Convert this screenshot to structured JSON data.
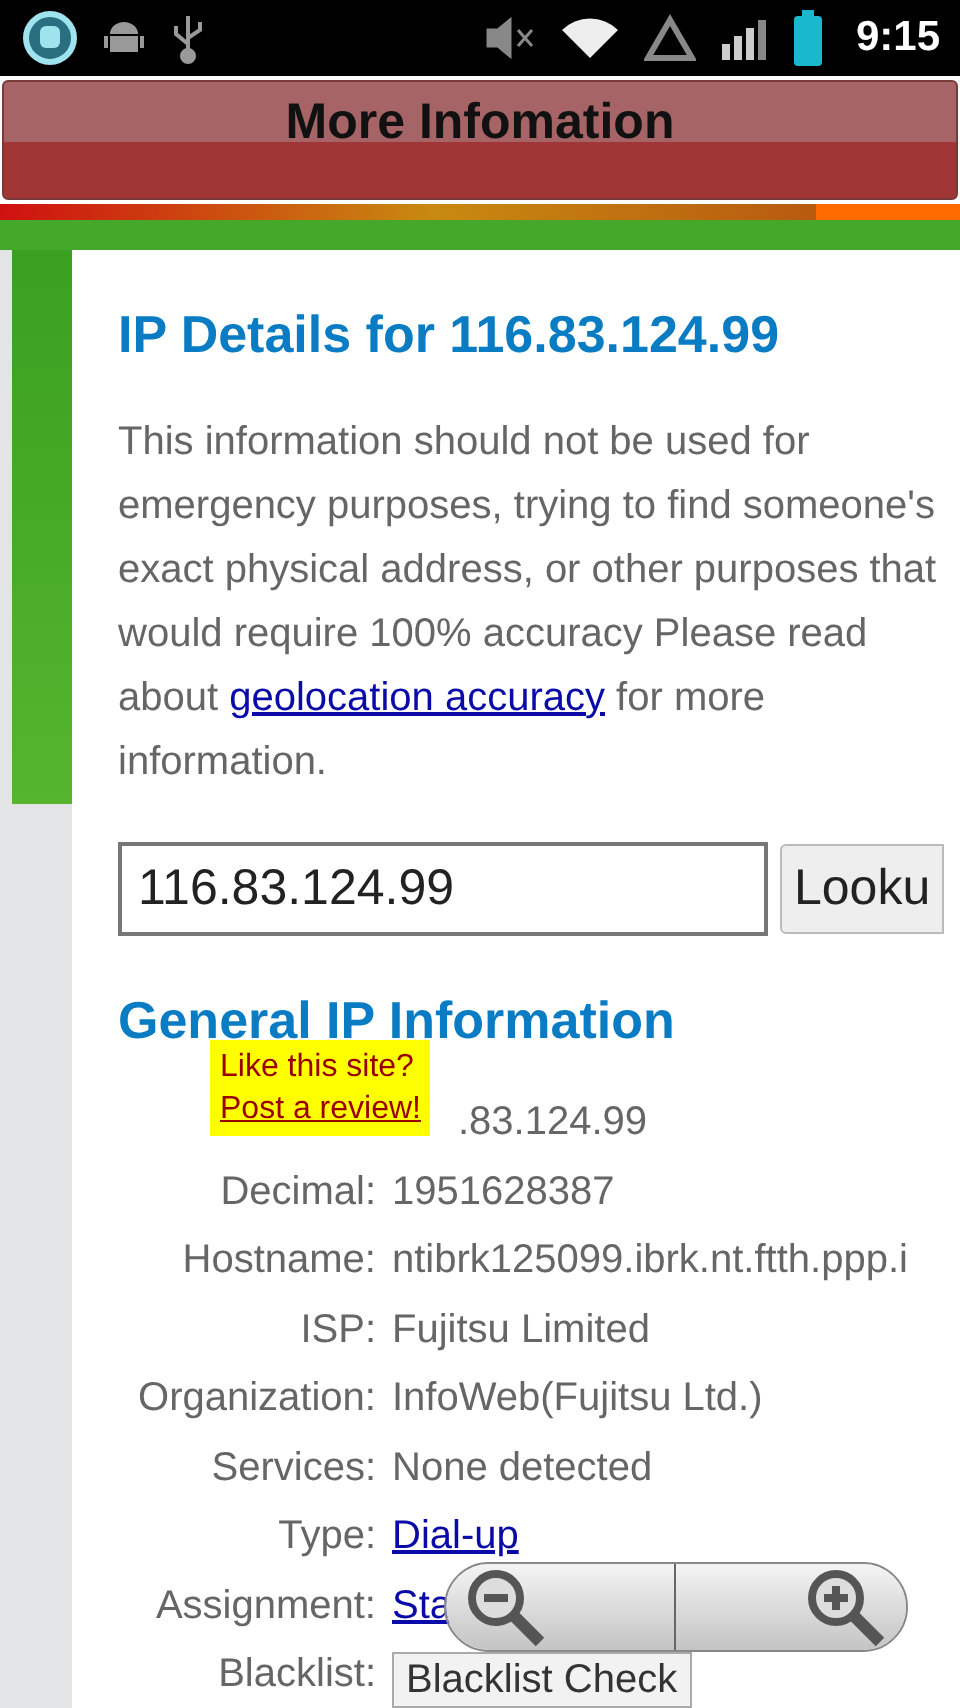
{
  "status_bar": {
    "time": "9:15"
  },
  "title_bar": {
    "title": "More Infomation"
  },
  "page": {
    "heading": "IP Details for 116.83.124.99",
    "notice_before": "This information should not be used for emergency purposes, trying to find someone's exact physical address, or other purposes that would require 100% accuracy Please read about",
    "notice_link": "geolocation accuracy",
    "notice_after": "for more information.",
    "lookup": {
      "value": "116.83.124.99",
      "button": "Looku"
    },
    "section_heading": "General IP Information",
    "review_tip": {
      "text": "Like this site?",
      "link": "Post a review!"
    },
    "details": [
      {
        "value": ".83.124.99",
        "kind": "text"
      },
      {
        "label": "Decimal:",
        "value": "1951628387",
        "kind": "text"
      },
      {
        "label": "Hostname:",
        "value": "ntibrk125099.ibrk.nt.ftth.ppp.i",
        "kind": "text"
      },
      {
        "label": "ISP:",
        "value": "Fujitsu Limited",
        "kind": "text"
      },
      {
        "label": "Organization:",
        "value": "InfoWeb(Fujitsu Ltd.)",
        "kind": "text"
      },
      {
        "label": "Services:",
        "value": "None detected",
        "kind": "text"
      },
      {
        "label": "Type:",
        "value": "Dial-up",
        "kind": "link"
      },
      {
        "label": "Assignment:",
        "value": "Sta",
        "kind": "link"
      },
      {
        "label": "Blacklist:",
        "value": "Blacklist Check",
        "kind": "button"
      }
    ]
  }
}
